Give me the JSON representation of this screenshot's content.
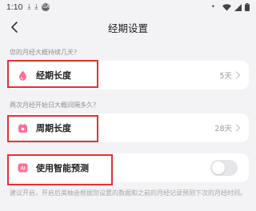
{
  "status_bar": {
    "time": "1:10",
    "notification_icons": [
      "download-icon",
      "download-icon",
      "vpn-key-icon"
    ],
    "badge": "GA",
    "right_icons": [
      "dot-icon",
      "wifi-icon",
      "signal-icon",
      "battery-icon"
    ]
  },
  "header": {
    "title": "经期设置"
  },
  "sections": {
    "period_question": "您的月经大概持续几天?",
    "cycle_question": "两次月经开始日大概间隔多久?"
  },
  "items": {
    "period_length": {
      "label": "经期长度",
      "value": "5天",
      "icon": "drop-icon"
    },
    "cycle_length": {
      "label": "周期长度",
      "value": "28天",
      "icon": "calendar-icon"
    },
    "smart_prediction": {
      "label": "使用智能预测",
      "icon": "ai-icon",
      "enabled": false
    }
  },
  "footnote": "建议开启，开启后美柚会根据您设置的数据和之前的月经记录预测下次的月经时间。",
  "colors": {
    "accent_pink": "#ff6f95",
    "background": "#f3f3f6",
    "highlight_red": "#e53030"
  }
}
